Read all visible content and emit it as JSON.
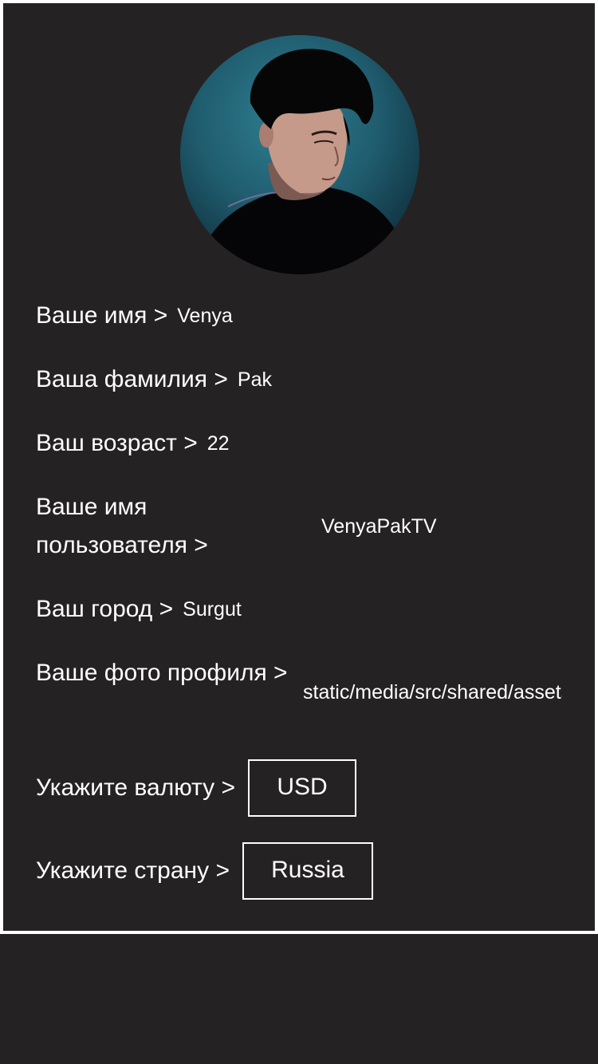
{
  "profile": {
    "avatar_alt": "profile-photo"
  },
  "fields": {
    "first_name": {
      "label": "Ваше имя >",
      "value": "Venya"
    },
    "last_name": {
      "label": "Ваша фамилия >",
      "value": "Pak"
    },
    "age": {
      "label": "Ваш возраст >",
      "value": "22"
    },
    "username": {
      "label": "Ваше имя пользователя >",
      "value": "VenyaPakTV"
    },
    "city": {
      "label": "Ваш город >",
      "value": "Surgut"
    },
    "photo": {
      "label": "Ваше фото профиля >",
      "value": "static/media/src/shared/assets"
    },
    "currency": {
      "label": "Укажите валюту >",
      "value": "USD"
    },
    "country": {
      "label": "Укажите страну >",
      "value": "Russia"
    }
  }
}
